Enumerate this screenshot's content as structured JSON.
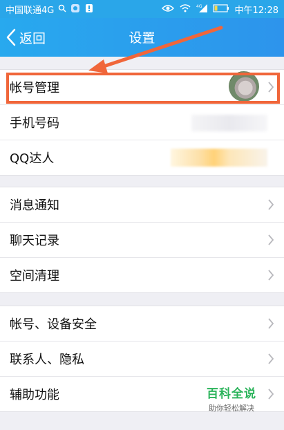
{
  "status_bar": {
    "carrier": "中国联通4G",
    "network": "4G",
    "time": "中午12:28"
  },
  "header": {
    "back_label": "返回",
    "title": "设置"
  },
  "groups": [
    {
      "items": [
        {
          "label": "帐号管理"
        },
        {
          "label": "手机号码"
        },
        {
          "label": "QQ达人"
        }
      ]
    },
    {
      "items": [
        {
          "label": "消息通知"
        },
        {
          "label": "聊天记录"
        },
        {
          "label": "空间清理"
        }
      ]
    },
    {
      "items": [
        {
          "label": "帐号、设备安全"
        },
        {
          "label": "联系人、隐私"
        },
        {
          "label": "辅助功能"
        }
      ]
    }
  ],
  "watermark": {
    "title": "百科全说",
    "subtitle": "助你轻松解决"
  },
  "colors": {
    "header": "#2aa6e9",
    "highlight": "#f0663a",
    "watermark": "#2ab35a"
  }
}
